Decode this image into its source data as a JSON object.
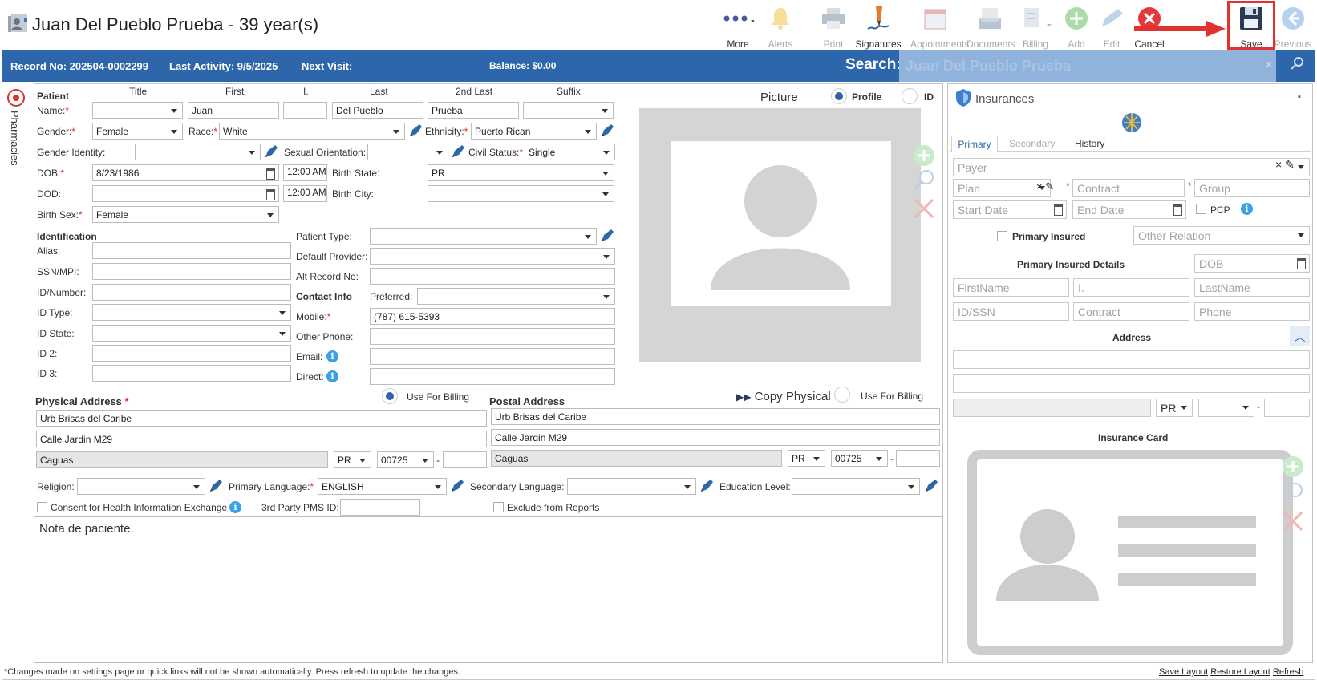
{
  "window": {
    "title": "Juan Del Pueblo Prueba - 39 year(s)"
  },
  "toolbar": {
    "more": "More",
    "alerts": "Alerts",
    "print": "Print",
    "signatures": "Signatures",
    "appointments": "Appointments",
    "documents": "Documents",
    "billing": "Billing",
    "add": "Add",
    "edit": "Edit",
    "cancel": "Cancel",
    "save": "Save",
    "previous": "Previous"
  },
  "infobar": {
    "record_no": "Record No: 202504-0002299",
    "last_activity": "Last Activity: 9/5/2025",
    "next_visit": "Next Visit:",
    "balance": "Balance: $0.00",
    "search_label": "Search:",
    "search_value": "Juan Del Pueblo Prueba"
  },
  "side_tab": {
    "label": "Pharmacies"
  },
  "patient": {
    "section": "Patient",
    "cols": {
      "title": "Title",
      "first": "First",
      "initial": "I.",
      "last": "Last",
      "second_last": "2nd Last",
      "suffix": "Suffix"
    },
    "name_label": "Name:",
    "first": "Juan",
    "last": "Del Pueblo",
    "second_last": "Prueba",
    "gender_label": "Gender:",
    "gender": "Female",
    "race_label": "Race:",
    "race": "White",
    "ethnicity_label": "Ethnicity:",
    "ethnicity": "Puerto Rican",
    "gender_identity_label": "Gender Identity:",
    "sexual_orientation_label": "Sexual Orientation:",
    "civil_status_label": "Civil Status:",
    "civil_status": "Single",
    "dob_label": "DOB:",
    "dob": "8/23/1986",
    "dob_time": "12:00 AM",
    "birth_state_label": "Birth State:",
    "birth_state": "PR",
    "dod_label": "DOD:",
    "dod_time": "12:00 AM",
    "birth_city_label": "Birth City:",
    "birth_sex_label": "Birth Sex:",
    "birth_sex": "Female"
  },
  "identification": {
    "section": "Identification",
    "alias": "Alias:",
    "ssn": "SSN/MPI:",
    "id_number": "ID/Number:",
    "id_type": "ID Type:",
    "id_state": "ID State:",
    "id2": "ID 2:",
    "id3": "ID 3:",
    "patient_type": "Patient Type:",
    "default_provider": "Default Provider:",
    "alt_record": "Alt Record No:",
    "contact_info": "Contact Info",
    "preferred": "Preferred:",
    "mobile_label": "Mobile:",
    "mobile": "(787) 615-5393",
    "other_phone": "Other Phone:",
    "email": "Email:",
    "direct": "Direct:"
  },
  "picture": {
    "label": "Picture",
    "profile": "Profile",
    "id": "ID"
  },
  "physical": {
    "title": "Physical Address",
    "use_billing": "Use For Billing",
    "line1": "Urb Brisas del Caribe",
    "line2": "Calle Jardin M29",
    "city": "Caguas",
    "state": "PR",
    "zip": "00725"
  },
  "postal": {
    "title": "Postal Address",
    "copy": "Copy Physical",
    "use_billing": "Use For Billing",
    "line1": "Urb Brisas del Caribe",
    "line2": "Calle Jardin M29",
    "city": "Caguas",
    "state": "PR",
    "zip": "00725"
  },
  "misc": {
    "religion": "Religion:",
    "primary_language_label": "Primary Language:",
    "primary_language": "ENGLISH",
    "secondary_language": "Secondary Language:",
    "education_level": "Education Level:",
    "consent": "Consent for Health Information Exchange",
    "pms_id": "3rd Party PMS ID:",
    "exclude": "Exclude from Reports",
    "note": "Nota de paciente."
  },
  "insurance": {
    "title": "Insurances",
    "tabs": [
      "Primary",
      "Secondary",
      "History"
    ],
    "payer": "Payer",
    "plan": "Plan",
    "contract": "Contract",
    "group": "Group",
    "start_date": "Start Date",
    "end_date": "End Date",
    "pcp": "PCP",
    "primary_insured": "Primary Insured",
    "other_relation": "Other Relation",
    "details": "Primary Insured Details",
    "dob": "DOB",
    "firstname": "FirstName",
    "initial": "I.",
    "lastname": "LastName",
    "id_ssn": "ID/SSN",
    "contract2": "Contract",
    "phone": "Phone",
    "address": "Address",
    "state": "PR",
    "card": "Insurance Card"
  },
  "footer": {
    "note": "*Changes made on settings page or quick links will not be shown automatically. Press refresh to update the changes.",
    "save_layout": "Save Layout",
    "restore_layout": "Restore Layout",
    "refresh": "Refresh"
  },
  "colors": {
    "accent": "#2d66aa",
    "highlight": "#e2312f"
  }
}
